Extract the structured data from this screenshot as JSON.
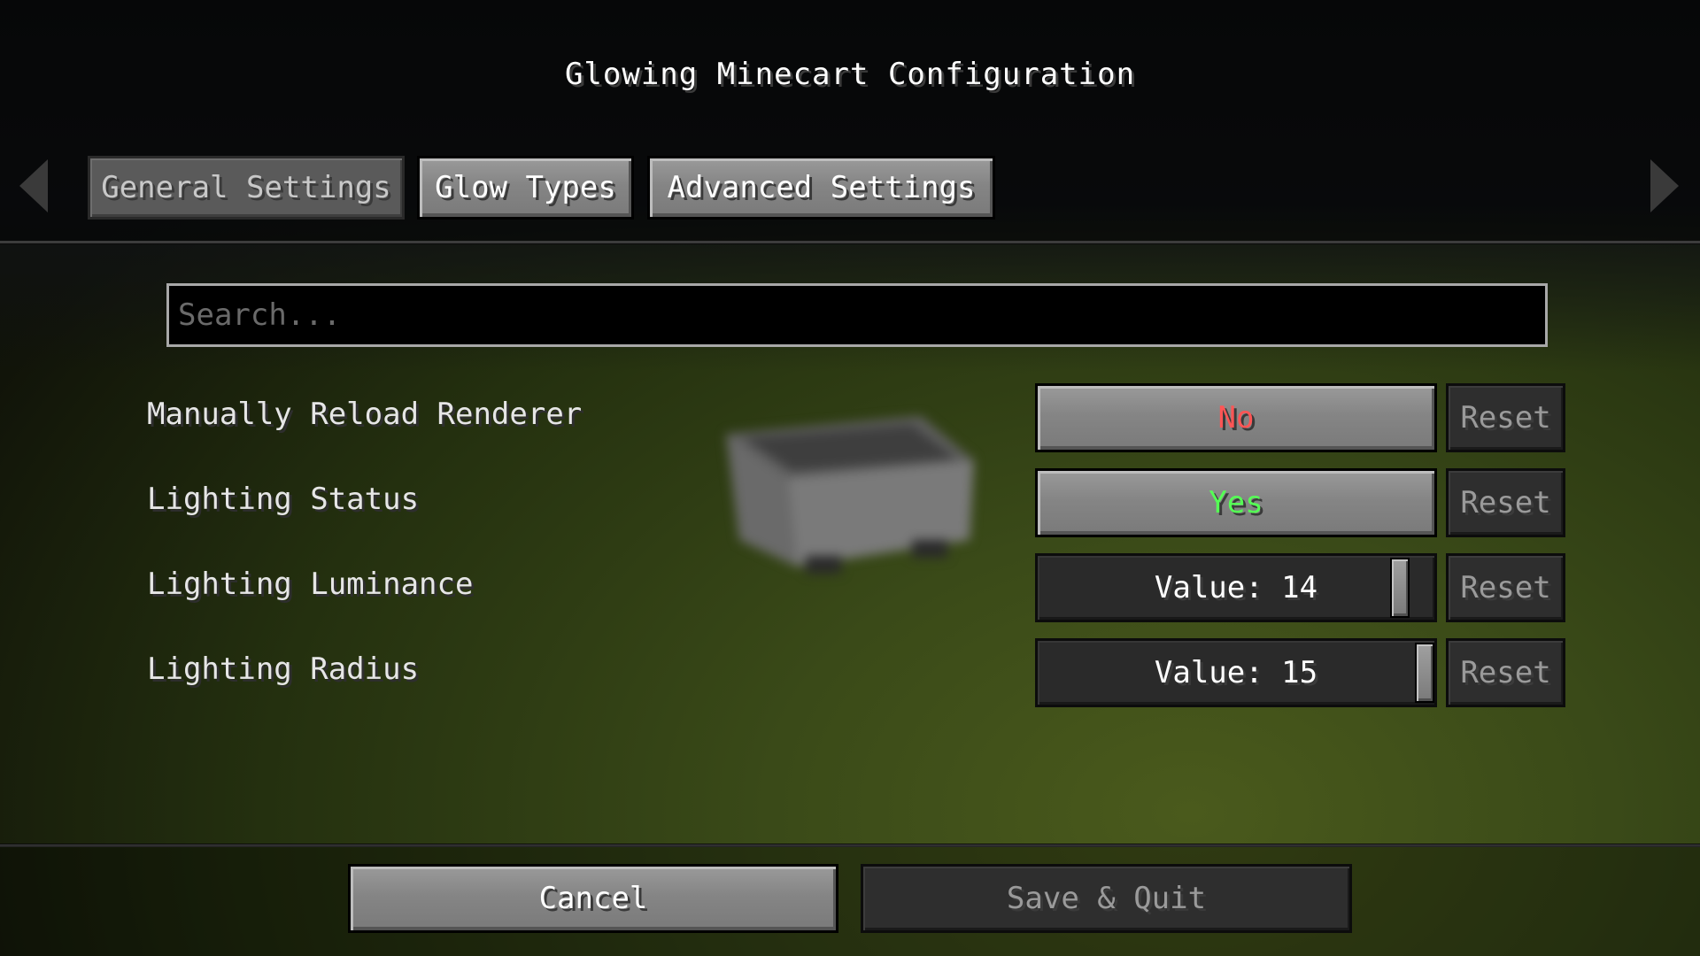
{
  "title": "Glowing Minecart Configuration",
  "tabs": [
    {
      "label": "General Settings",
      "state": "inactive"
    },
    {
      "label": "Glow Types",
      "state": "active"
    },
    {
      "label": "Advanced Settings",
      "state": "active"
    }
  ],
  "nav": {
    "prev_icon": "arrow-left-icon",
    "next_icon": "arrow-right-icon"
  },
  "search": {
    "placeholder": "Search...",
    "value": ""
  },
  "options": [
    {
      "label": "Manually Reload Renderer",
      "type": "toggle",
      "value": "No",
      "value_color": "#ff5555",
      "reset_label": "Reset"
    },
    {
      "label": "Lighting Status",
      "type": "toggle",
      "value": "Yes",
      "value_color": "#55ff55",
      "reset_label": "Reset"
    },
    {
      "label": "Lighting Luminance",
      "type": "slider",
      "value": "Value: 14",
      "level": 14,
      "max": 15,
      "reset_label": "Reset"
    },
    {
      "label": "Lighting Radius",
      "type": "slider",
      "value": "Value: 15",
      "level": 15,
      "max": 15,
      "reset_label": "Reset"
    }
  ],
  "footer": {
    "cancel_label": "Cancel",
    "save_label": "Save & Quit"
  },
  "colors": {
    "no": "#ff5555",
    "yes": "#55ff55"
  }
}
